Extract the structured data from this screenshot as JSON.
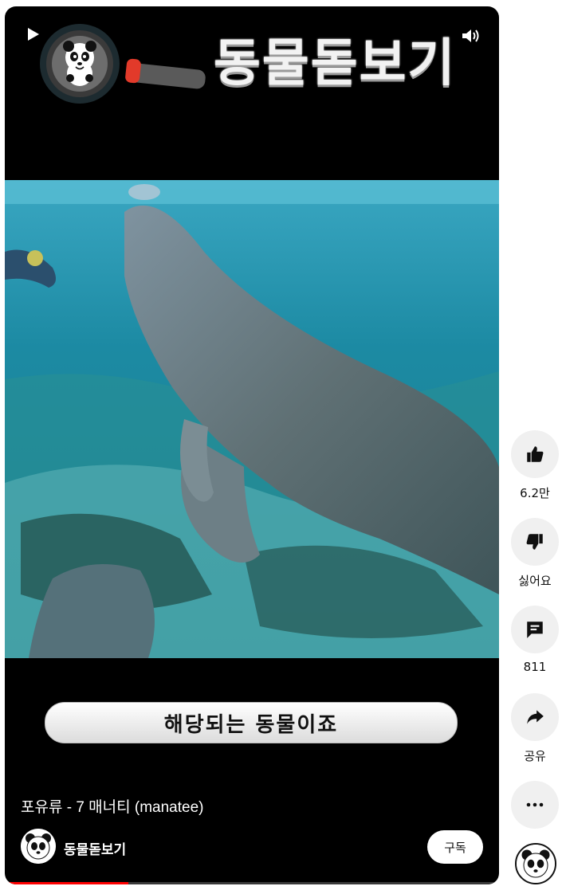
{
  "overlay": {
    "brand_title": "동물돋보기",
    "caption": "해당되는 동물이죠"
  },
  "video": {
    "title": "포유류 - 7 매너티 (manatee)",
    "progress_fraction": 0.25
  },
  "channel": {
    "name": "동물돋보기",
    "subscribe_label": "구독"
  },
  "actions": {
    "like_count": "6.2만",
    "dislike_label": "싫어요",
    "comment_count": "811",
    "share_label": "공유"
  },
  "icons": {
    "play": "play-icon",
    "volume": "volume-icon",
    "like": "thumbs-up-icon",
    "dislike": "thumbs-down-icon",
    "comment": "comment-icon",
    "share": "share-icon",
    "more": "more-icon"
  },
  "colors": {
    "progress": "#ff0000",
    "water": "#1f8fa4",
    "action_bg": "#f0f0f0"
  }
}
